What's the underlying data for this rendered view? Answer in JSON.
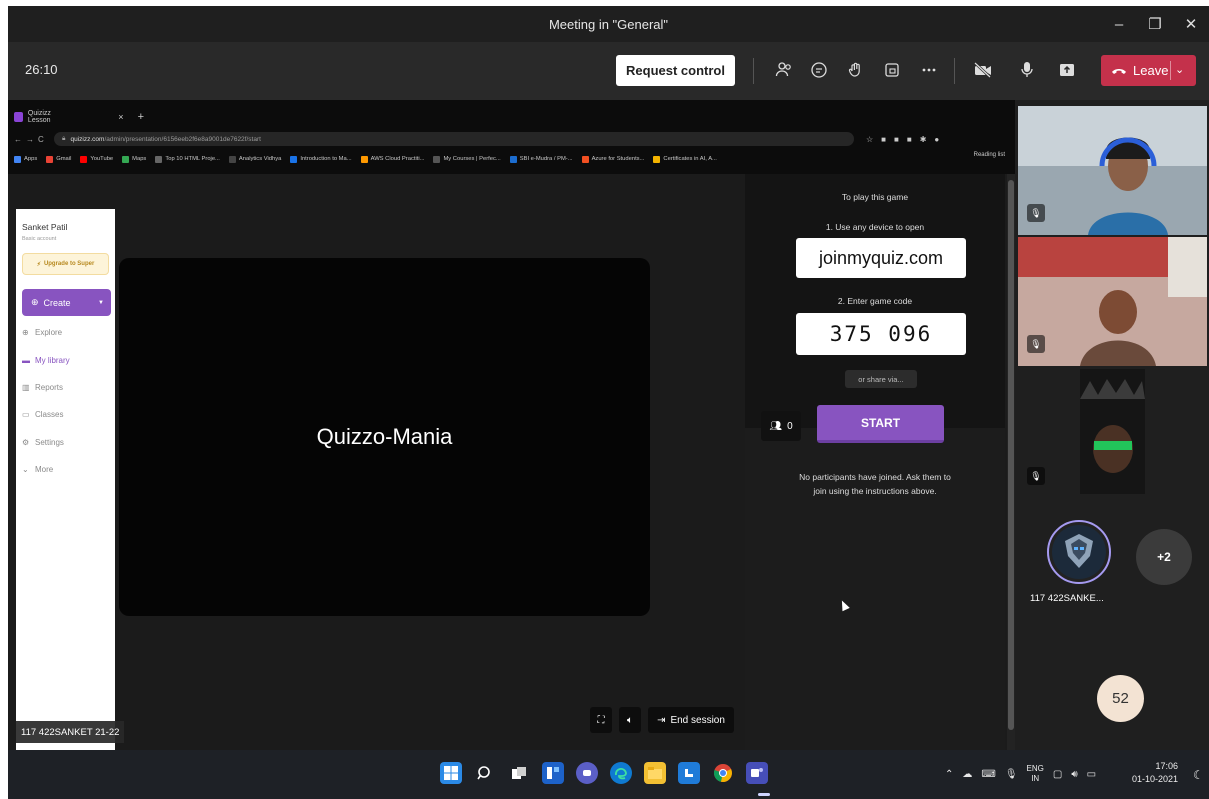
{
  "window": {
    "title": "Meeting in \"General\"",
    "controls": {
      "minimize": "–",
      "restore": "❐",
      "close": "✕"
    }
  },
  "toolbar": {
    "timer": "26:10",
    "request_control_label": "Request control",
    "leave_label": "Leave",
    "icons": [
      "participants-icon",
      "chat-icon",
      "raise-hand-icon",
      "rooms-icon",
      "more-icon",
      "camera-off-icon",
      "mic-icon",
      "share-icon"
    ]
  },
  "browser": {
    "tab_title": "Quizizz Lesson",
    "url_host": "quizizz.com",
    "url_path": "/admin/presentation/6156eeb2f6e8a9001de7622f/start",
    "bookmarks": [
      {
        "label": "Apps",
        "color": "#4285f4"
      },
      {
        "label": "Gmail",
        "color": "#ea4335"
      },
      {
        "label": "YouTube",
        "color": "#ff0000"
      },
      {
        "label": "Maps",
        "color": "#34a853"
      },
      {
        "label": "Top 10 HTML Proje...",
        "color": "#666666"
      },
      {
        "label": "Analytics Vidhya",
        "color": "#444444"
      },
      {
        "label": "Introduction to Ma...",
        "color": "#1a73e8"
      },
      {
        "label": "AWS Cloud Practiti...",
        "color": "#ff9900"
      },
      {
        "label": "My Courses | Perfec...",
        "color": "#555555"
      },
      {
        "label": "SBI e-Mudra / PM-...",
        "color": "#1c6dd0"
      },
      {
        "label": "Azure for Students...",
        "color": "#f25022"
      },
      {
        "label": "Certificates in AI, A...",
        "color": "#f4b400"
      }
    ],
    "reading_list": "Reading list"
  },
  "quizizz": {
    "user_name": "Sanket Patil",
    "account_type": "Basic account",
    "upgrade_label": "Upgrade to Super",
    "create_label": "Create",
    "nav": [
      {
        "label": "Explore",
        "icon": "explore-icon",
        "glyph": "⊕",
        "active": false
      },
      {
        "label": "My library",
        "icon": "library-icon",
        "glyph": "▬",
        "active": true
      },
      {
        "label": "Reports",
        "icon": "reports-icon",
        "glyph": "▥",
        "active": false
      },
      {
        "label": "Classes",
        "icon": "classes-icon",
        "glyph": "▭",
        "active": false
      },
      {
        "label": "Settings",
        "icon": "settings-icon",
        "glyph": "⚙",
        "active": false
      },
      {
        "label": "More",
        "icon": "more-chevron-icon",
        "glyph": "⌄",
        "active": false
      }
    ],
    "presenter_label": "117 422SANKET 21-22",
    "stage_title": "Quizzo-Mania",
    "end_session_label": "End session",
    "play_heading": "To play this game",
    "step1": "1. Use any device to open",
    "join_url": "joinmyquiz.com",
    "step2": "2. Enter game code",
    "game_code": "375 096",
    "share_label": "or share via...",
    "participant_count": "0",
    "start_label": "START",
    "no_participants_line1": "No participants have joined. Ask them to",
    "no_participants_line2": "join using the instructions above."
  },
  "participants": {
    "named_tile": "117 422SANKE...",
    "overflow": "+2",
    "count_badge": "52"
  },
  "taskbar": {
    "apps": [
      "windows-icon",
      "search-icon",
      "task-view-icon",
      "widgets-icon",
      "chat-icon",
      "edge-icon",
      "file-explorer-icon",
      "store-icon",
      "chrome-icon",
      "teams-icon"
    ],
    "lang_top": "ENG",
    "lang_bottom": "IN",
    "time": "17:06",
    "date": "01-10-2021"
  },
  "colors": {
    "teams_bg": "#1f1f1f",
    "leave_red": "#c4314b",
    "quizizz_purple": "#8854c0"
  }
}
